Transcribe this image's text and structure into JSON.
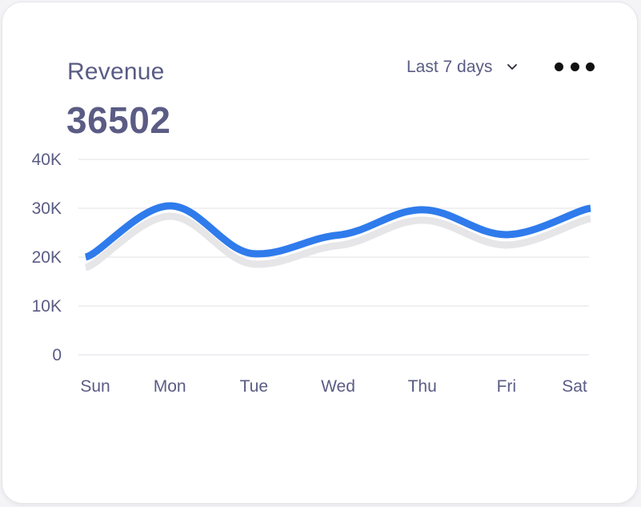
{
  "card": {
    "title": "Revenue",
    "value": "36502",
    "range_label": "Last 7 days"
  },
  "icons": {
    "range_dropdown": "chevron-down-icon",
    "more": "more-horizontal-icon"
  },
  "colors": {
    "line": "#2f7bec",
    "shadow": "#e6e6e9",
    "text": "#5a5c84",
    "grid": "#ececef"
  },
  "chart_data": {
    "type": "line",
    "categories": [
      "Sun",
      "Mon",
      "Tue",
      "Wed",
      "Thu",
      "Fri",
      "Sat"
    ],
    "series": [
      {
        "values": [
          20000,
          30500,
          20700,
          24500,
          29700,
          24600,
          30000
        ]
      }
    ],
    "ylim": [
      0,
      40000
    ],
    "y_ticks": [
      {
        "value": 40000,
        "label": "40K"
      },
      {
        "value": 30000,
        "label": "30K"
      },
      {
        "value": 20000,
        "label": "20K"
      },
      {
        "value": 10000,
        "label": "10K"
      },
      {
        "value": 0,
        "label": "0"
      }
    ],
    "grid": true,
    "smooth": true,
    "xlabel": "",
    "ylabel": ""
  }
}
